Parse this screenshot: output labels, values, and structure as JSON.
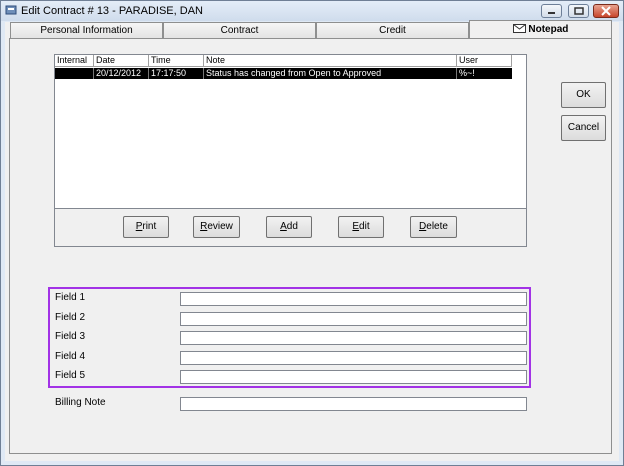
{
  "window": {
    "title": "Edit Contract # 13 - PARADISE, DAN",
    "controls": {
      "minimize_icon": "minimize-icon",
      "maximize_icon": "maximize-icon",
      "close_icon": "close-icon"
    }
  },
  "tabs": [
    {
      "label": "Personal Information",
      "active": false
    },
    {
      "label": "Contract",
      "active": false
    },
    {
      "label": "Credit",
      "active": false
    },
    {
      "label": "Notepad",
      "active": true,
      "icon": "envelope-icon"
    }
  ],
  "notes_table": {
    "columns": [
      "Internal",
      "Date",
      "Time",
      "Note",
      "User"
    ],
    "rows": [
      {
        "internal": "",
        "date": "20/12/2012",
        "time": "17:17:50",
        "note": "Status has changed from Open to Approved",
        "user": "%~!"
      }
    ]
  },
  "note_buttons": {
    "print": {
      "pre": "",
      "key": "P",
      "post": "rint"
    },
    "review": {
      "pre": "",
      "key": "R",
      "post": "eview"
    },
    "add": {
      "pre": "",
      "key": "A",
      "post": "dd"
    },
    "edit": {
      "pre": "",
      "key": "E",
      "post": "dit"
    },
    "delete": {
      "pre": "",
      "key": "D",
      "post": "elete"
    }
  },
  "side_buttons": {
    "ok": "OK",
    "cancel": "Cancel"
  },
  "fields": [
    {
      "label": "Field 1",
      "value": ""
    },
    {
      "label": "Field 2",
      "value": ""
    },
    {
      "label": "Field 3",
      "value": ""
    },
    {
      "label": "Field 4",
      "value": ""
    },
    {
      "label": "Field 5",
      "value": ""
    }
  ],
  "billing_note": {
    "label": "Billing Note",
    "value": ""
  },
  "colors": {
    "highlight": "#a232e6",
    "selection": "#000000",
    "title_bar": "#dfe9f5"
  }
}
